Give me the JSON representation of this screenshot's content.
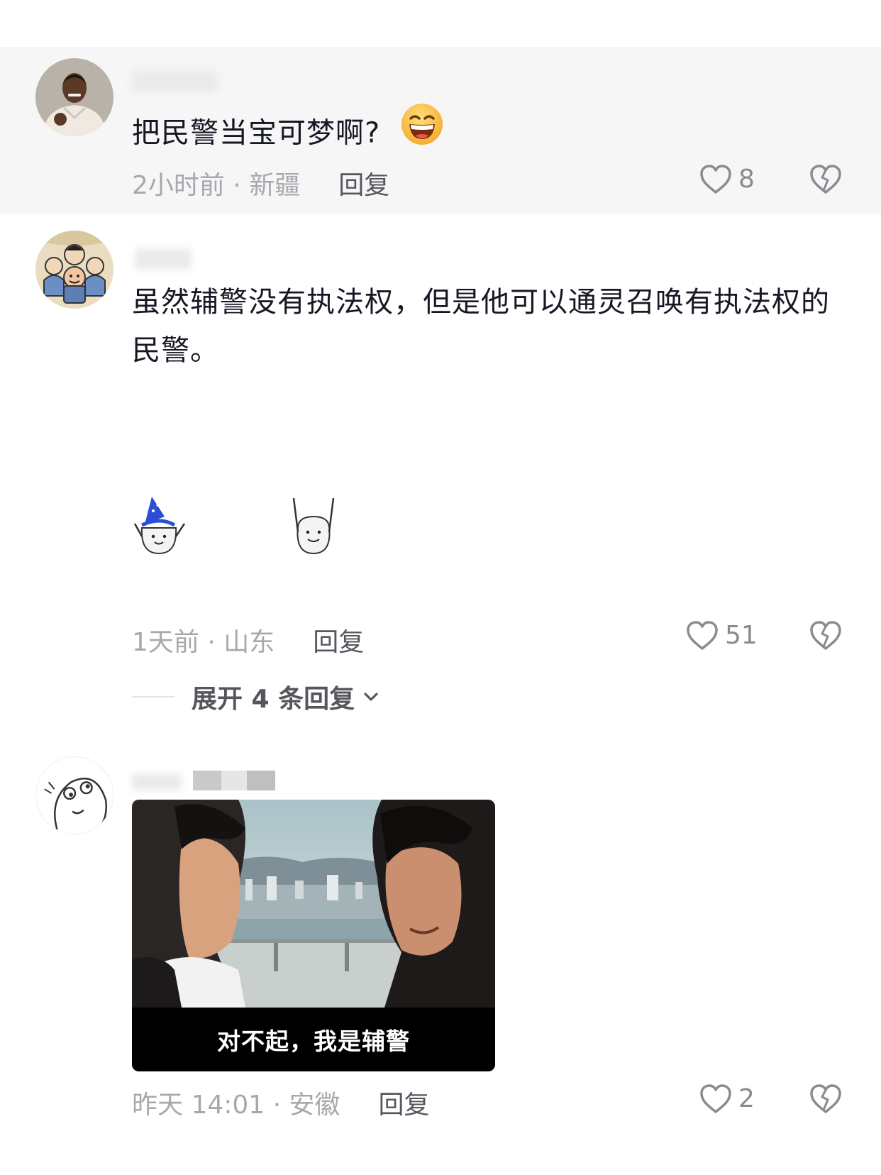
{
  "comments": [
    {
      "avatar": "man-in-white-shirt-avatar",
      "text": "把民警当宝可梦啊?",
      "emoji": "grinning-face-emoji",
      "time_location": "2小时前 · 新疆",
      "reply_label": "回复",
      "likes": "8"
    },
    {
      "avatar": "cartoon-group-avatar",
      "text": "虽然辅警没有执法权，但是他可以通灵召唤有执法权的民警。",
      "stickers": [
        "wizard-hat-cat-sticker",
        "hands-up-cat-sticker"
      ],
      "time_location": "1天前 · 山东",
      "reply_label": "回复",
      "likes": "51",
      "expand_label": "展开 4 条回复"
    },
    {
      "avatar": "doodle-face-avatar",
      "image_caption": "对不起，我是辅警",
      "time_location": "昨天 14:01 · 安徽",
      "reply_label": "回复",
      "likes": "2"
    }
  ],
  "colors": {
    "text": "#161823",
    "meta": "#a7a8ad",
    "reply": "#56575e",
    "highlight_band": "#f6f6f7",
    "emoji": "#f7c13a"
  },
  "icons": [
    "heart-outline-icon",
    "broken-heart-icon",
    "chevron-down-icon"
  ]
}
